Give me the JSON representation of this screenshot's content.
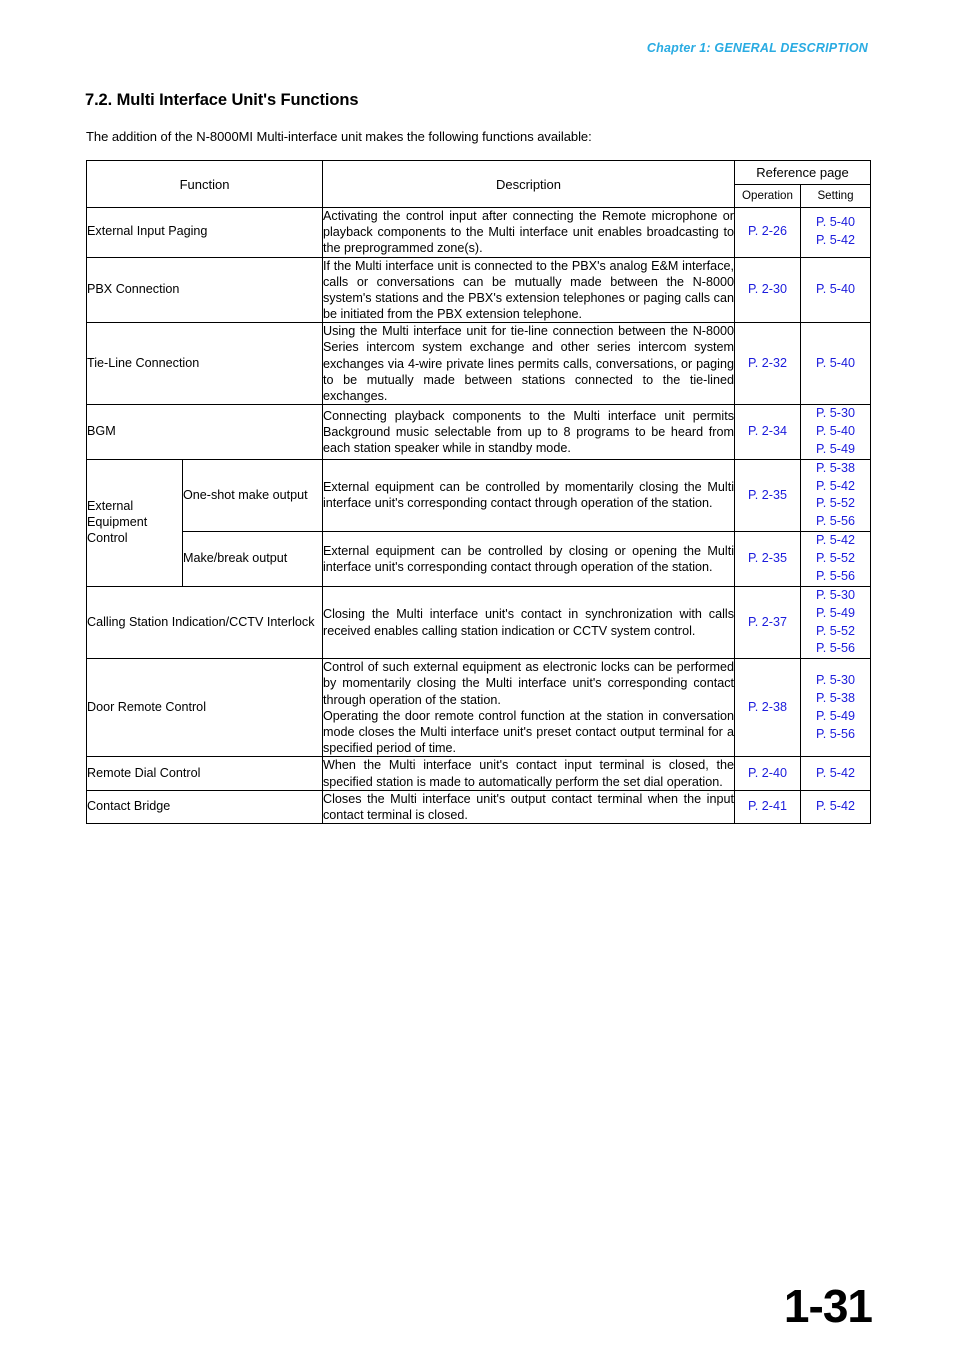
{
  "running_head": "Chapter 1:  GENERAL DESCRIPTION",
  "section": {
    "title": "7.2. Multi Interface Unit's Functions",
    "intro": "The addition of the N-8000MI Multi-interface unit makes the following functions available:"
  },
  "table": {
    "headers": {
      "function": "Function",
      "description": "Description",
      "reference_page": "Reference page",
      "operation": "Operation",
      "setting": "Setting"
    },
    "rows": [
      {
        "function": "External Input Paging",
        "sub": null,
        "description": "Activating the control input after connecting the Remote microphone or playback components to the Multi interface unit enables broadcasting to the preprogrammed zone(s).",
        "operation": [
          "P. 2-26"
        ],
        "setting": [
          "P. 5-40",
          "P. 5-42"
        ]
      },
      {
        "function": "PBX Connection",
        "sub": null,
        "description": "If the Multi interface unit is connected to the PBX's analog E&M interface, calls or conversations can be mutually made between the N-8000 system's stations and the PBX's extension telephones or paging calls can be initiated from the PBX extension telephone.",
        "operation": [
          "P. 2-30"
        ],
        "setting": [
          "P. 5-40"
        ]
      },
      {
        "function": "Tie-Line Connection",
        "sub": null,
        "description": "Using the Multi interface unit for tie-line connection between the N-8000 Series intercom system exchange and other series intercom system exchanges via 4-wire private lines permits calls, conversations, or paging to be mutually made between stations connected to the tie-lined exchanges.",
        "operation": [
          "P. 2-32"
        ],
        "setting": [
          "P. 5-40"
        ]
      },
      {
        "function": "BGM",
        "sub": null,
        "description": "Connecting playback components to the Multi interface unit permits Background music selectable from up to 8 programs to be heard from each station speaker while in standby mode.",
        "operation": [
          "P. 2-34"
        ],
        "setting": [
          "P. 5-30",
          "P. 5-40",
          "P. 5-49"
        ]
      },
      {
        "function": "External Equipment Control",
        "sub": "One-shot make output",
        "description": "External equipment can be controlled by momentarily closing the Multi interface unit's corresponding contact through operation of the station.",
        "operation": [
          "P. 2-35"
        ],
        "setting": [
          "P. 5-38",
          "P. 5-42",
          "P. 5-52",
          "P. 5-56"
        ]
      },
      {
        "function": null,
        "sub": "Make/break output",
        "description": "External equipment can be controlled by closing or opening the Multi interface unit's corresponding contact through operation of the station.",
        "operation": [
          "P. 2-35"
        ],
        "setting": [
          "P. 5-42",
          "P. 5-52",
          "P. 5-56"
        ]
      },
      {
        "function": "Calling Station Indication/CCTV Interlock",
        "sub": null,
        "description": "Closing the Multi interface unit's contact in synchronization with calls received enables calling station indication or CCTV system control.",
        "operation": [
          "P. 2-37"
        ],
        "setting": [
          "P. 5-30",
          "P. 5-49",
          "P. 5-52",
          "P. 5-56"
        ]
      },
      {
        "function": "Door Remote Control",
        "sub": null,
        "description": "Control of such external equipment as electronic locks can be performed by momentarily closing the Multi interface unit's corresponding contact through operation of the station.\nOperating the door remote control function at the station in conversation mode closes the Multi interface unit's preset contact output terminal for a specified period of time.",
        "operation": [
          "P. 2-38"
        ],
        "setting": [
          "P. 5-30",
          "P. 5-38",
          "P. 5-49",
          "P. 5-56"
        ]
      },
      {
        "function": "Remote Dial Control",
        "sub": null,
        "description": "When the Multi interface unit's contact input terminal is closed, the specified station is made to automatically perform the set dial operation.",
        "operation": [
          "P. 2-40"
        ],
        "setting": [
          "P. 5-42"
        ]
      },
      {
        "function": "Contact Bridge",
        "sub": null,
        "description": "Closes the Multi interface unit's output contact terminal when the input contact terminal is closed.",
        "operation": [
          "P. 2-41"
        ],
        "setting": [
          "P. 5-42"
        ]
      }
    ]
  },
  "folio": "1-31",
  "colors": {
    "running_head": "#29abe2",
    "reference_link": "#1b1bdc",
    "text": "#000000",
    "rule": "#000000"
  }
}
